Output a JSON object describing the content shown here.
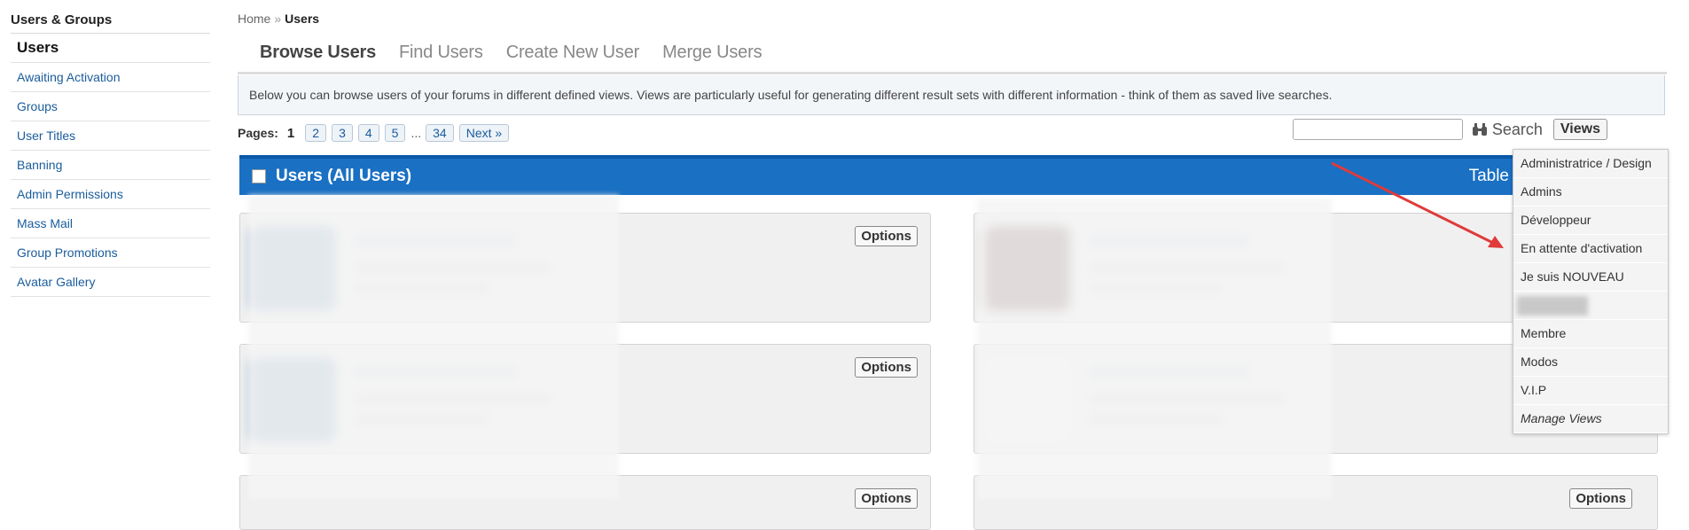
{
  "sidebar": {
    "title": "Users & Groups",
    "items": [
      {
        "label": "Users",
        "active": true
      },
      {
        "label": "Awaiting Activation"
      },
      {
        "label": "Groups"
      },
      {
        "label": "User Titles"
      },
      {
        "label": "Banning"
      },
      {
        "label": "Admin Permissions"
      },
      {
        "label": "Mass Mail"
      },
      {
        "label": "Group Promotions"
      },
      {
        "label": "Avatar Gallery"
      }
    ]
  },
  "breadcrumb": {
    "home": "Home",
    "separator": "»",
    "current": "Users"
  },
  "tabs": [
    "Browse Users",
    "Find Users",
    "Create New User",
    "Merge Users"
  ],
  "description": "Below you can browse users of your forums in different defined views. Views are particularly useful for generating different result sets with different information - think of them as saved live searches.",
  "pager": {
    "label": "Pages:",
    "current": "1",
    "pages": [
      "2",
      "3",
      "4",
      "5"
    ],
    "dots": "...",
    "last": "34",
    "next": "Next »"
  },
  "search": {
    "placeholder": "",
    "button_label": "Search",
    "views_label": "Views"
  },
  "table_header": {
    "title": "Users (All Users)",
    "right_label": "Table"
  },
  "cards": {
    "options_label": "Options"
  },
  "views_menu": {
    "items": [
      "Administratrice / Design",
      "Admins",
      "Développeur",
      "En attente d'activation",
      "Je suis NOUVEAU",
      "",
      "Membre",
      "Modos",
      "V.I.P"
    ],
    "manage": "Manage Views"
  },
  "colors": {
    "accent_blue": "#1a70c2",
    "link": "#1a5c9c",
    "annotation_arrow": "#e03a3a"
  }
}
